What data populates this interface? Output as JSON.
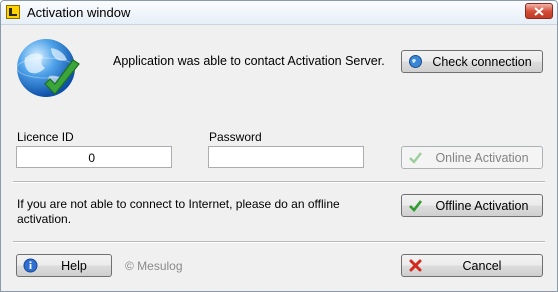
{
  "window": {
    "title": "Activation window"
  },
  "status": {
    "message": "Application was able to contact Activation Server."
  },
  "buttons": {
    "check_connection": "Check connection",
    "online_activation": "Online Activation",
    "offline_activation": "Offline Activation",
    "help": "Help",
    "cancel": "Cancel"
  },
  "licence": {
    "label": "Licence ID",
    "value": "0"
  },
  "password": {
    "label": "Password",
    "value": ""
  },
  "offline": {
    "message": "If you are not able to connect to Internet, please do an offline activation."
  },
  "footer": {
    "copyright": "© Mesulog"
  },
  "colors": {
    "check_green": "#3aa53a",
    "globe_blue": "#1f6fc6",
    "cancel_red": "#d42a1e"
  }
}
